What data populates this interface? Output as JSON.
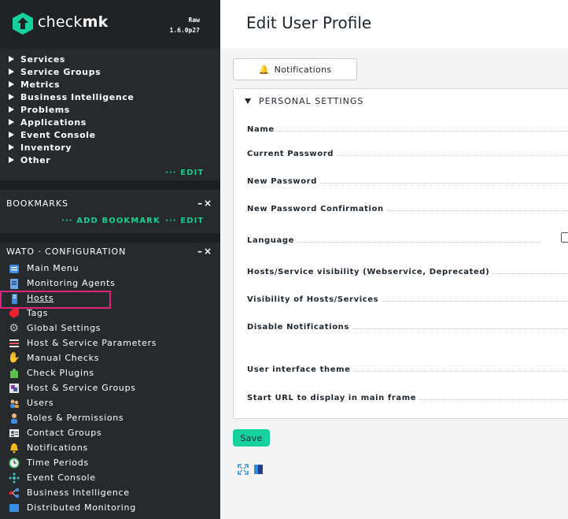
{
  "brand": {
    "name_light": "check",
    "name_bold": "mk",
    "edition": "Raw",
    "version": "1.6.0p27"
  },
  "sidebar": {
    "views": {
      "items": [
        "Services",
        "Service Groups",
        "Metrics",
        "Business Intelligence",
        "Problems",
        "Applications",
        "Event Console",
        "Inventory",
        "Other"
      ],
      "edit_label": "··· EDIT"
    },
    "bookmarks": {
      "title": "BOOKMARKS",
      "controls": "–×",
      "add_label": "··· ADD BOOKMARK",
      "edit_label": "··· EDIT"
    },
    "wato": {
      "title": "WATO · CONFIGURATION",
      "controls": "–×",
      "items": [
        {
          "label": "Main Menu",
          "icon": "main-menu-icon"
        },
        {
          "label": "Monitoring Agents",
          "icon": "agents-icon"
        },
        {
          "label": "Hosts",
          "icon": "hosts-icon"
        },
        {
          "label": "Tags",
          "icon": "tags-icon"
        },
        {
          "label": "Global Settings",
          "icon": "gear-icon"
        },
        {
          "label": "Host & Service Parameters",
          "icon": "parameters-icon"
        },
        {
          "label": "Manual Checks",
          "icon": "hand-icon"
        },
        {
          "label": "Check Plugins",
          "icon": "puzzle-icon"
        },
        {
          "label": "Host & Service Groups",
          "icon": "groups-icon"
        },
        {
          "label": "Users",
          "icon": "users-icon"
        },
        {
          "label": "Roles & Permissions",
          "icon": "roles-icon"
        },
        {
          "label": "Contact Groups",
          "icon": "contact-groups-icon"
        },
        {
          "label": "Notifications",
          "icon": "bell-icon"
        },
        {
          "label": "Time Periods",
          "icon": "clock-icon"
        },
        {
          "label": "Event Console",
          "icon": "event-console-icon"
        },
        {
          "label": "Business Intelligence",
          "icon": "bi-icon"
        },
        {
          "label": "Distributed Monitoring",
          "icon": "distributed-icon"
        }
      ]
    }
  },
  "main": {
    "title": "Edit User Profile",
    "notifications_button": "Notifications",
    "settings_title": "PERSONAL SETTINGS",
    "fields": [
      "Name",
      "Current Password",
      "New Password",
      "New Password Confirmation",
      "Language",
      "Hosts/Service visibility (Webservice, Deprecated)",
      "Visibility of Hosts/Services",
      "Disable Notifications",
      "User interface theme",
      "Start URL to display in main frame"
    ],
    "save_button": "Save"
  },
  "colors": {
    "accent_green": "#16d18c",
    "save_green": "#15d1a0",
    "highlight": "#e0227a",
    "sidebar_bg": "#262a2d"
  }
}
